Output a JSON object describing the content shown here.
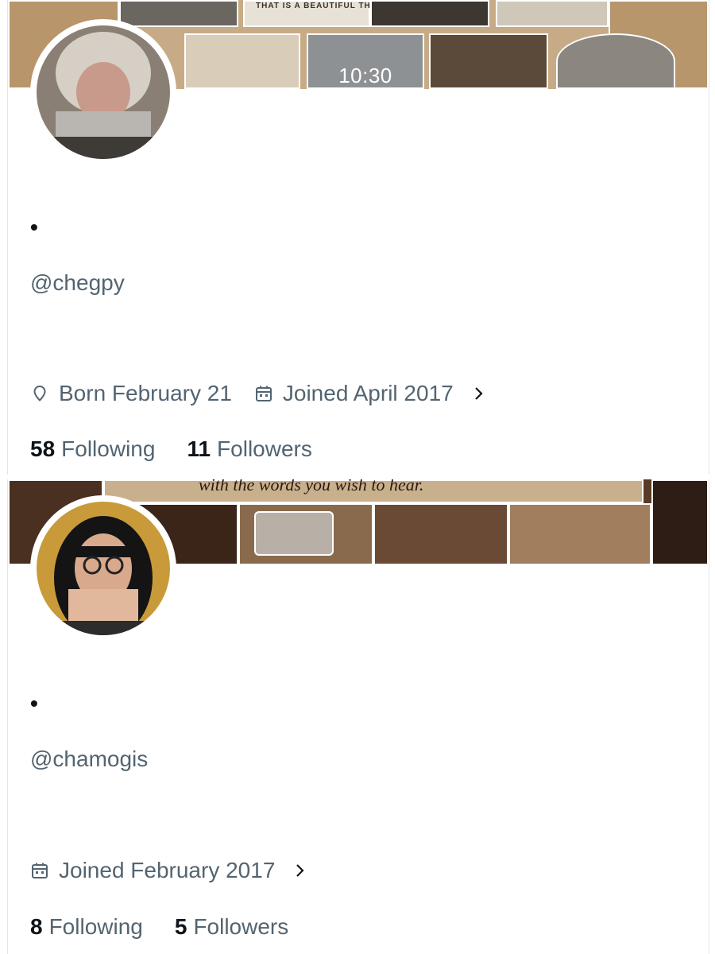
{
  "profiles": [
    {
      "display_name": "•",
      "handle": "@chegpy",
      "banner_text": "THAT IS A BEAUTIFUL THING",
      "banner_clock": "10:30",
      "born": "Born February 21",
      "joined": "Joined April 2017",
      "following_count": "58",
      "following_label": "Following",
      "followers_count": "11",
      "followers_label": "Followers"
    },
    {
      "display_name": "•",
      "handle": "@chamogis",
      "banner_text": "with the words you wish to hear.",
      "joined": "Joined February 2017",
      "following_count": "8",
      "following_label": "Following",
      "followers_count": "5",
      "followers_label": "Followers"
    }
  ],
  "icons": {
    "location": "location-pin-icon",
    "calendar": "calendar-icon",
    "chevron": "chevron-right-icon"
  },
  "colors": {
    "text_primary": "#0f1419",
    "text_secondary": "#536471",
    "background": "#ffffff"
  }
}
